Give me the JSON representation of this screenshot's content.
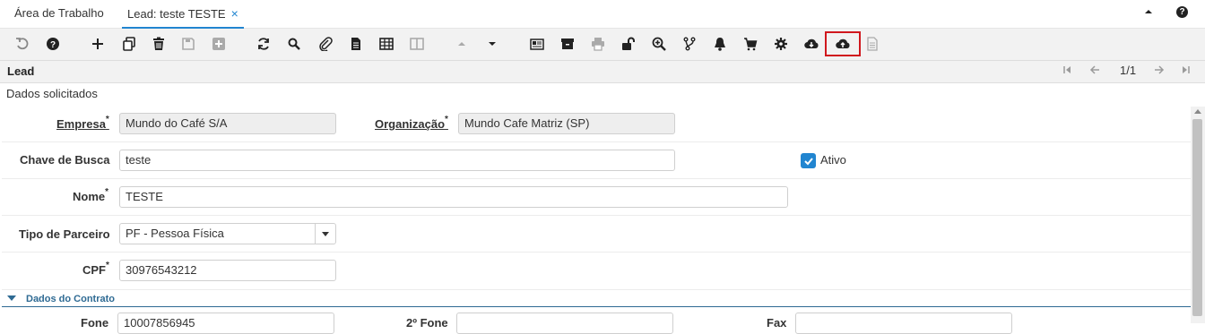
{
  "tabs": [
    {
      "label": "Área de Trabalho"
    },
    {
      "label": "Lead: teste TESTE",
      "close": "×"
    }
  ],
  "help_glyph": "?",
  "toolbar": {
    "icons": [
      "undo-icon",
      "help-icon",
      "new-icon",
      "copy-icon",
      "delete-icon",
      "save-icon",
      "save-new-icon",
      "refresh-icon",
      "find-icon",
      "attachment-icon",
      "note-icon",
      "grid-toggle-icon",
      "split-view-icon",
      "previous-record-icon",
      "next-record-icon",
      "report-icon",
      "archive-icon",
      "print-icon",
      "lock-icon",
      "zoom-across-icon",
      "workflow-icon",
      "notice-icon",
      "cart-icon",
      "process-icon",
      "download-cloud-icon",
      "upload-cloud-icon",
      "document-icon"
    ],
    "highlighted": "upload-cloud-icon",
    "highlight_color": "#d0171d"
  },
  "window": {
    "title": "Lead",
    "record_count": "1/1"
  },
  "section_title": "Dados solicitados",
  "form": {
    "empresa": {
      "label": "Empresa",
      "required": "*",
      "value": "Mundo do Café S/A"
    },
    "organizacao": {
      "label": "Organização",
      "required": "*",
      "value": "Mundo Cafe Matriz (SP)"
    },
    "chave": {
      "label": "Chave de Busca",
      "value": "teste"
    },
    "ativo": {
      "label": "Ativo",
      "checked": true
    },
    "nome": {
      "label": "Nome",
      "required": "*",
      "value": "TESTE"
    },
    "tipo": {
      "label": "Tipo de Parceiro",
      "value": "PF - Pessoa Física"
    },
    "cpf": {
      "label": "CPF",
      "required": "*",
      "value": "30976543212"
    }
  },
  "group": {
    "title": "Dados do Contrato"
  },
  "partial_row": {
    "fone_label": "Fone",
    "fone_value": "10007856945",
    "fone2_label": "2º Fone",
    "fax_label": "Fax"
  },
  "colors": {
    "accent": "#2185d0",
    "group": "#2e6a93",
    "toolbar_bg": "#f2f2f2"
  }
}
